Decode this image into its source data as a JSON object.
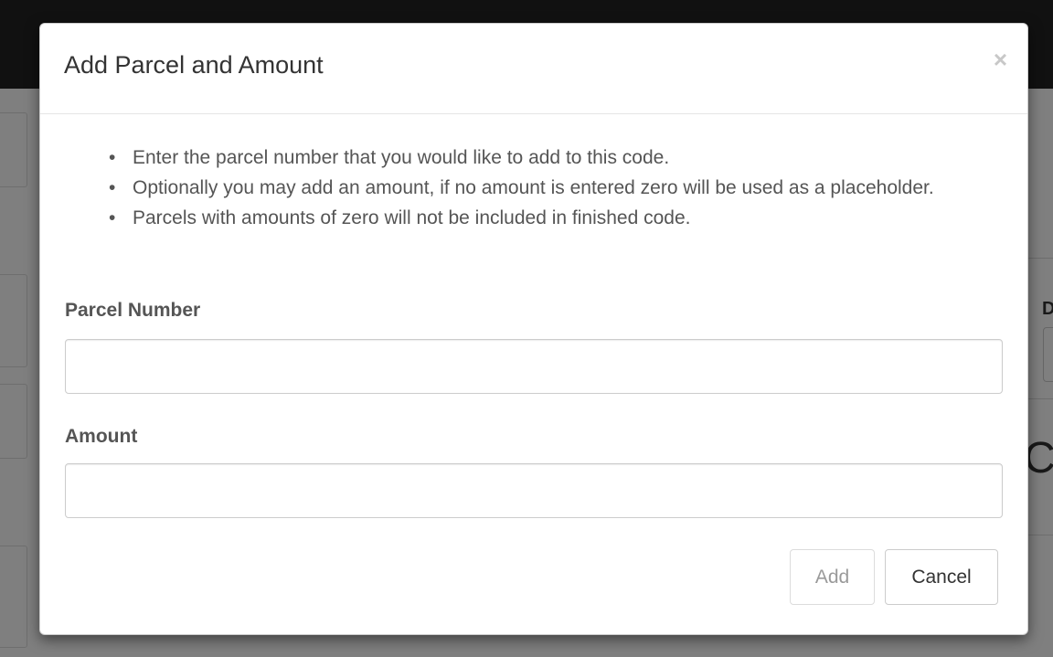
{
  "background": {
    "right_label_fragment": "D",
    "right_heading_fragment": "C"
  },
  "modal": {
    "title": "Add Parcel and Amount",
    "close_glyph": "×",
    "instructions": [
      "Enter the parcel number that you would like to add to this code.",
      "Optionally you may add an amount, if no amount is entered zero will be used as a placeholder.",
      "Parcels with amounts of zero will not be included in finished code."
    ],
    "bullet_glyph": "•",
    "fields": {
      "parcel_label": "Parcel Number",
      "parcel_value": "",
      "amount_label": "Amount",
      "amount_value": ""
    },
    "buttons": {
      "add_label": "Add",
      "add_disabled": true,
      "cancel_label": "Cancel"
    }
  }
}
